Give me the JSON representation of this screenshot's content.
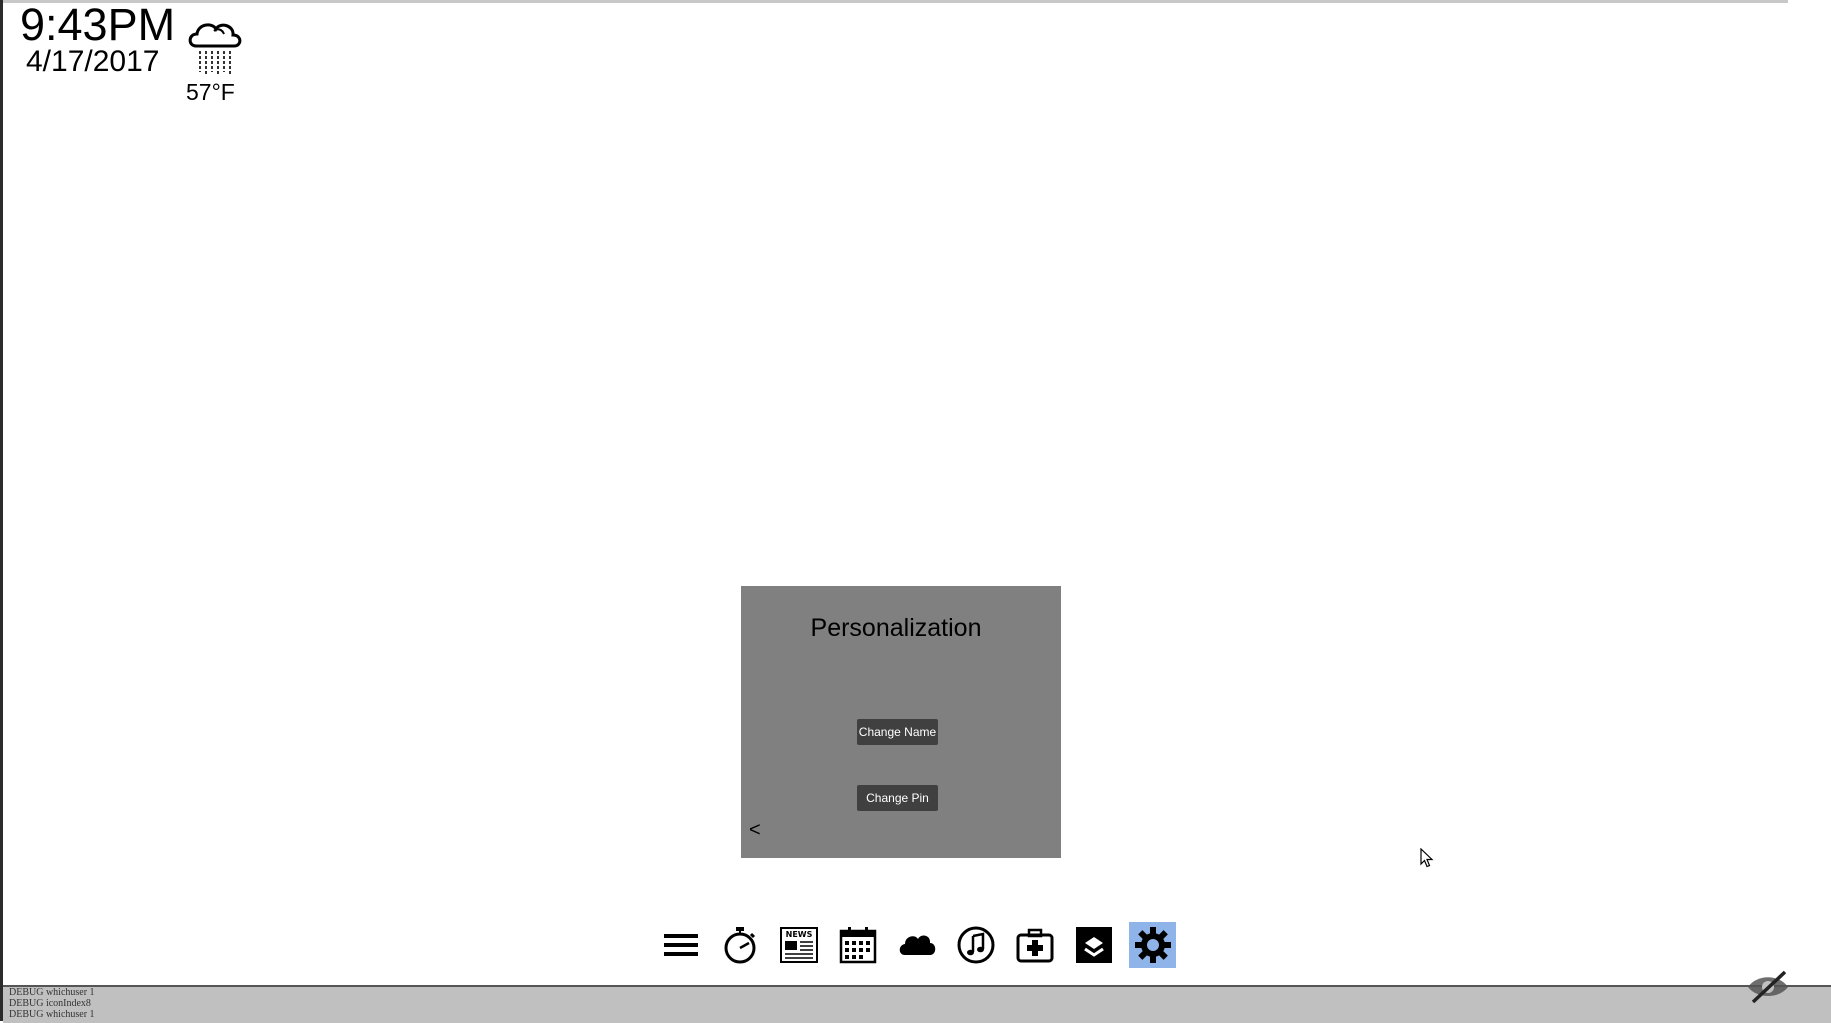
{
  "clock": {
    "time": "9:43PM",
    "date": "4/17/2017"
  },
  "weather": {
    "icon": "rain-cloud-icon",
    "temperature": "57°F"
  },
  "panel": {
    "title": "Personalization",
    "buttons": {
      "change_name": "Change Name",
      "change_pin": "Change Pin"
    },
    "back_label": "<"
  },
  "dock": {
    "items": [
      {
        "icon": "menu-icon"
      },
      {
        "icon": "stopwatch-icon"
      },
      {
        "icon": "news-icon"
      },
      {
        "icon": "calendar-icon"
      },
      {
        "icon": "cloud-icon"
      },
      {
        "icon": "music-icon"
      },
      {
        "icon": "health-kit-icon"
      },
      {
        "icon": "layers-box-icon"
      },
      {
        "icon": "settings-gear-icon",
        "active": true
      }
    ],
    "active_color": "#8fb4ea"
  },
  "debug": {
    "lines": [
      "DEBUG whichuser 1",
      "DEBUG iconIndex8",
      "DEBUG whichuser 1"
    ]
  },
  "colors": {
    "panel_bg": "#808080",
    "button_bg": "#404040",
    "debug_bar_bg": "#c0c0c0"
  }
}
